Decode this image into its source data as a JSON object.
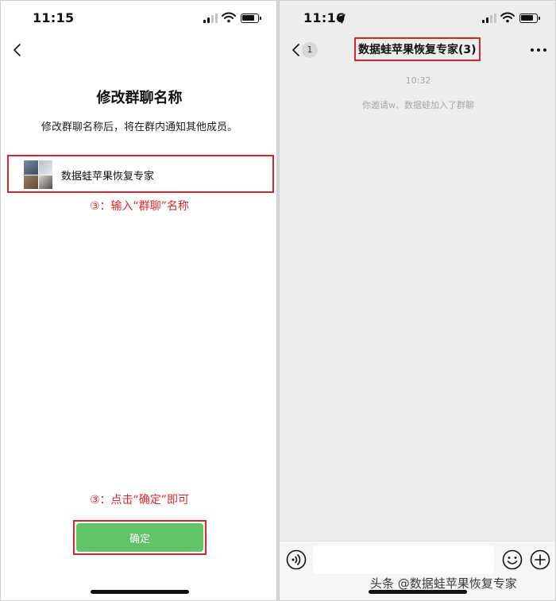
{
  "left_screen": {
    "status_time": "11:15",
    "title": "修改群聊名称",
    "subtitle": "修改群聊名称后，将在群内通知其他成员。",
    "group_name_value": "数据蛙苹果恢复专家",
    "annotation_input": "③：输入“群聊”名称",
    "annotation_confirm": "③：点击“确定”即可",
    "confirm_label": "确定"
  },
  "right_screen": {
    "status_time": "11:16",
    "unread_count": "1",
    "chat_title": "数据蛙苹果恢复专家(3)",
    "message_time": "10:32",
    "system_message": "你邀请w、数据蛙加入了群聊",
    "message_input_value": ""
  },
  "watermark": "头条 @数据蛙苹果恢复专家",
  "colors": {
    "annotation_red": "#d9262c",
    "confirm_green": "#5fc368",
    "chat_background": "#ededed"
  },
  "icons": [
    "back-chevron-icon",
    "signal-icon",
    "wifi-icon",
    "battery-icon",
    "location-arrow-icon",
    "more-icon",
    "voice-icon",
    "emoji-icon",
    "plus-icon"
  ]
}
